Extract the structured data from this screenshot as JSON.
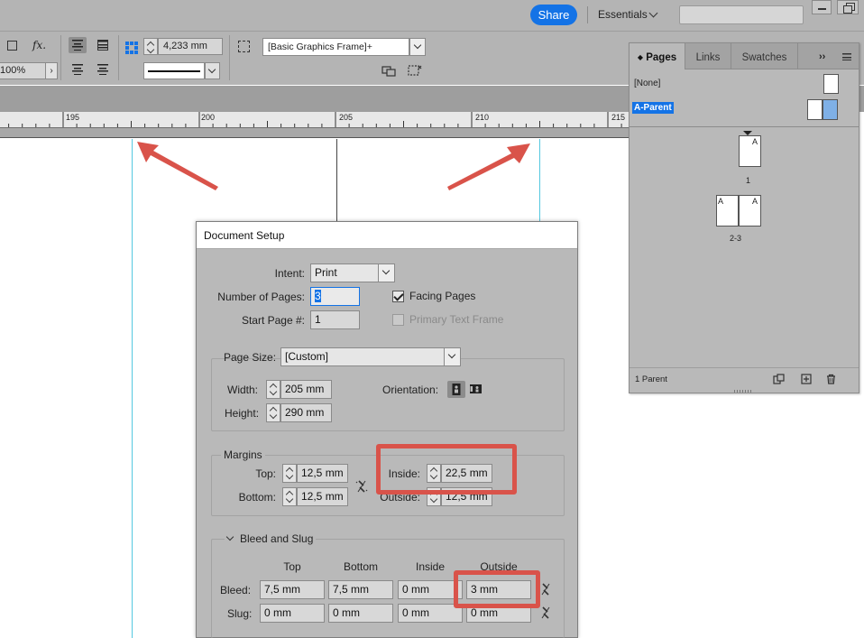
{
  "appbar": {
    "share_label": "Share",
    "workspace_label": "Essentials"
  },
  "control_panel": {
    "opacity_value": "100%",
    "ref_value": "4,233 mm",
    "object_style": "[Basic Graphics Frame]+"
  },
  "ruler": {
    "labels": [
      "195",
      "200",
      "205",
      "210",
      "215"
    ]
  },
  "pages_panel": {
    "tabs": [
      "Pages",
      "Links",
      "Swatches"
    ],
    "more_label": "››",
    "parent_none": "[None]",
    "parent_a": "A-Parent",
    "page_1_prefix": "A",
    "page_1_label": "1",
    "spread_left_prefix": "A",
    "spread_right_prefix": "A",
    "spread_label": "2-3",
    "footer_status": "1 Parent"
  },
  "document_setup": {
    "title": "Document Setup",
    "intent_label": "Intent:",
    "intent_value": "Print",
    "num_pages_label": "Number of Pages:",
    "num_pages_value": "3",
    "facing_pages_label": "Facing Pages",
    "facing_pages_checked": true,
    "start_page_label": "Start Page #:",
    "start_page_value": "1",
    "primary_text_frame_label": "Primary Text Frame",
    "primary_text_frame_checked": false,
    "page_size_label": "Page Size:",
    "page_size_value": "[Custom]",
    "width_label": "Width:",
    "width_value": "205 mm",
    "height_label": "Height:",
    "height_value": "290 mm",
    "orientation_label": "Orientation:",
    "margins_title": "Margins",
    "top_label": "Top:",
    "top_value": "12,5 mm",
    "bottom_label": "Bottom:",
    "bottom_value": "12,5 mm",
    "inside_label": "Inside:",
    "inside_value": "22,5 mm",
    "outside_label": "Outside:",
    "outside_value": "12,5 mm",
    "bleed_slug_title": "Bleed and Slug",
    "col_top": "Top",
    "col_bottom": "Bottom",
    "col_inside": "Inside",
    "col_outside": "Outside",
    "bleed_label": "Bleed:",
    "bleed_top": "7,5 mm",
    "bleed_bottom": "7,5 mm",
    "bleed_inside": "0 mm",
    "bleed_outside": "3 mm",
    "slug_label": "Slug:",
    "slug_top": "0 mm",
    "slug_bottom": "0 mm",
    "slug_inside": "0 mm",
    "slug_outside": "0 mm"
  },
  "colors": {
    "accent": "#1473e6",
    "annotation_red": "#d9534a",
    "guide_cyan": "#54c8e0"
  }
}
